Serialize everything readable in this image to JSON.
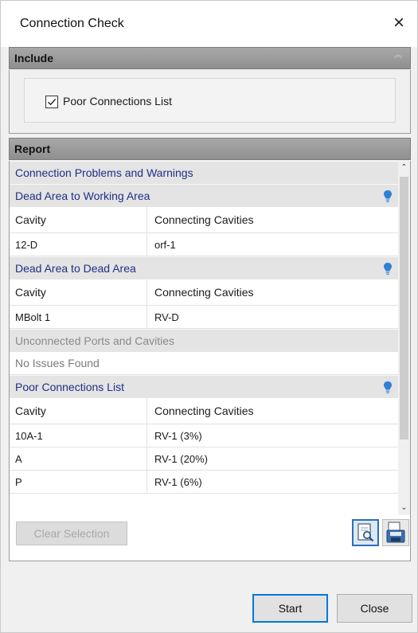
{
  "window": {
    "title": "Connection Check",
    "close_glyph": "×"
  },
  "include": {
    "header": "Include",
    "checkbox_label": "Poor Connections List",
    "checkbox_checked": true
  },
  "report": {
    "header": "Report",
    "rows": {
      "r0": "Connection Problems and Warnings",
      "r1": "Dead Area to Working Area",
      "r2": {
        "c1": "Cavity",
        "c2": "Connecting Cavities"
      },
      "r3": {
        "c1": "12-D",
        "c2": "orf-1"
      },
      "r4": "Dead Area to Dead Area",
      "r5": {
        "c1": "Cavity",
        "c2": "Connecting Cavities"
      },
      "r6": {
        "c1": "MBolt 1",
        "c2": "RV-D"
      },
      "r7": "Unconnected Ports and Cavities",
      "r8": "No Issues Found",
      "r9": "Poor Connections List",
      "r10": {
        "c1": "Cavity",
        "c2": "Connecting Cavities"
      },
      "r11": {
        "c1": "10A-1",
        "c2": "RV-1 (3%)"
      },
      "r12": {
        "c1": "A",
        "c2": "RV-1 (20%)"
      },
      "r13": {
        "c1": "P",
        "c2": "RV-1 (6%)"
      }
    },
    "clear_selection_label": "Clear Selection"
  },
  "buttons": {
    "start": "Start",
    "close": "Close"
  },
  "colors": {
    "group_text": "#1f2f86",
    "disabled_text": "#8a8a8a",
    "bulb": "#2f7fd6",
    "section_header": "#999999"
  },
  "icons": {
    "bulb": "lightbulb-icon",
    "preview": "page-preview-icon",
    "save": "save-report-icon"
  }
}
